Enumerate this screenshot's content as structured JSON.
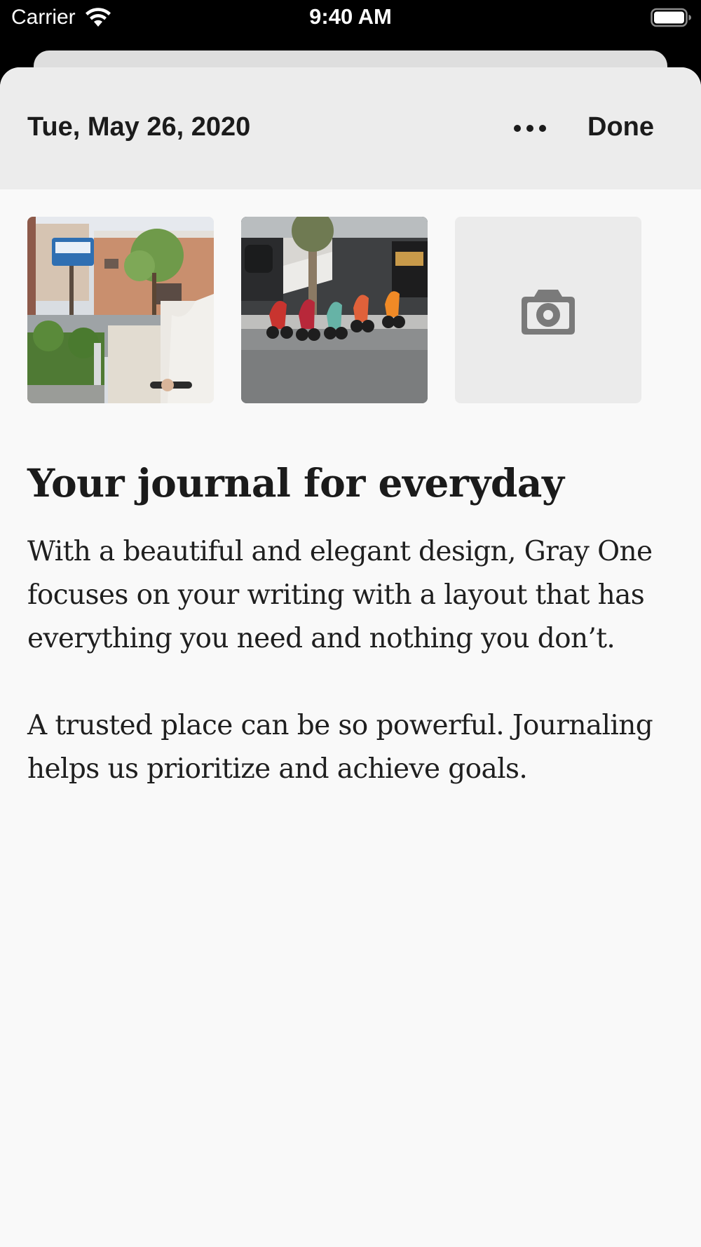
{
  "status_bar": {
    "carrier": "Carrier",
    "time": "9:40 AM",
    "wifi_icon": "wifi-icon",
    "battery_icon": "battery-icon"
  },
  "sheet": {
    "date": "Tue, May 26, 2020",
    "more_icon": "ellipsis-icon",
    "done_label": "Done"
  },
  "photos": [
    {
      "description_icon": "street-sign-photo"
    },
    {
      "description_icon": "scooters-photo"
    }
  ],
  "add_photo_icon": "camera-icon",
  "entry": {
    "title": "Your journal for everyday",
    "paragraphs": [
      "With a beautiful and elegant design, Gray One focuses on your writing with a layout that has everything you need and nothing you don’t.",
      "A trusted place can be so powerful. Journaling helps us prioritize and achieve goals."
    ]
  },
  "colors": {
    "status_bar_bg": "#000000",
    "header_bg": "#ececec",
    "sheet_bg": "#f9f9f9",
    "text": "#1b1b1b",
    "placeholder_bg": "#ebebeb",
    "camera_icon": "#7a7a7a"
  }
}
